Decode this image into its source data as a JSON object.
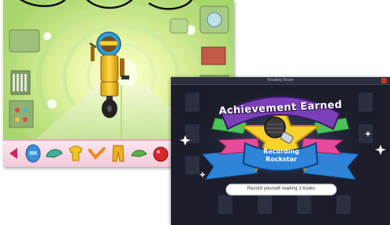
{
  "achievement_popup": {
    "title": "Achievement Earned",
    "badge_name_line1": "Recording",
    "badge_name_line2": "Rockstar",
    "description": "Record yourself reading 3 books",
    "window_title": "Reading Room"
  },
  "robot_scene": {
    "nav_arrow": "left-arrow-icon",
    "wardrobe_items": [
      "helmet-icon",
      "hat-icon",
      "shirt-icon",
      "arm-icon",
      "pants-icon",
      "hat-icon",
      "body-icon"
    ]
  },
  "colors": {
    "tunnel_green": "#c9e88a",
    "robot_gold": "#f2c21a",
    "tray_pink": "#f5cddc",
    "banner_purple": "#7b3fb8",
    "star_yellow": "#f6d22a",
    "ribbon_blue": "#2d84d8"
  }
}
